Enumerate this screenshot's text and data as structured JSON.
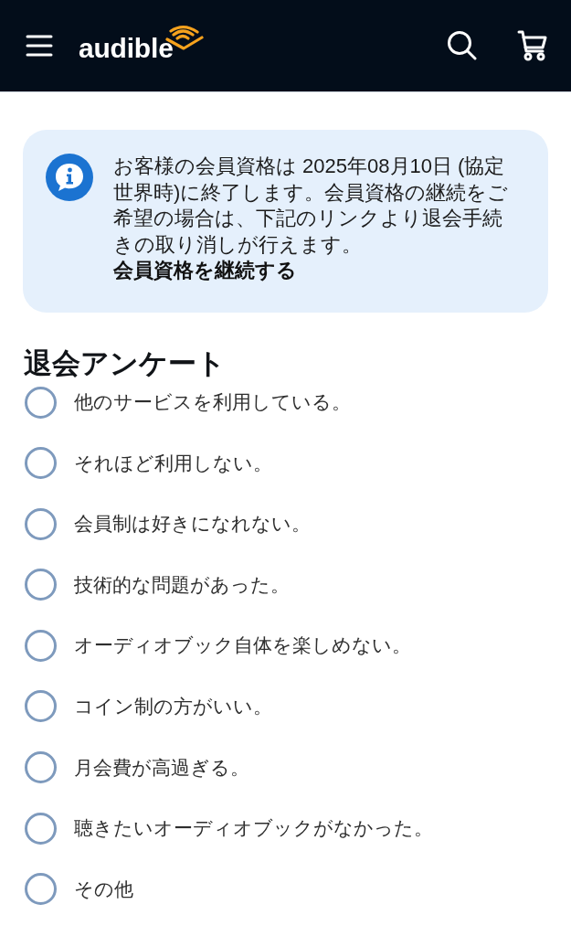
{
  "header": {
    "logo": "audible"
  },
  "notice": {
    "message": "お客様の会員資格は 2025年08月10日 (協定世界時)に終了します。会員資格の継続をご希望の場合は、下記のリンクより退会手続きの取り消しが行えます。",
    "link": "会員資格を継続する"
  },
  "survey": {
    "title": "退会アンケート",
    "options": [
      {
        "label": "他のサービスを利用している。",
        "selected": false
      },
      {
        "label": "それほど利用しない。",
        "selected": false
      },
      {
        "label": "会員制は好きになれない。",
        "selected": false
      },
      {
        "label": "技術的な問題があった。",
        "selected": false
      },
      {
        "label": "オーディオブック自体を楽しめない。",
        "selected": false
      },
      {
        "label": "コイン制の方がいい。",
        "selected": false
      },
      {
        "label": "月会費が高過ぎる。",
        "selected": false
      },
      {
        "label": "聴きたいオーディオブックがなかった。",
        "selected": false
      },
      {
        "label": "その他",
        "selected": false
      }
    ]
  }
}
